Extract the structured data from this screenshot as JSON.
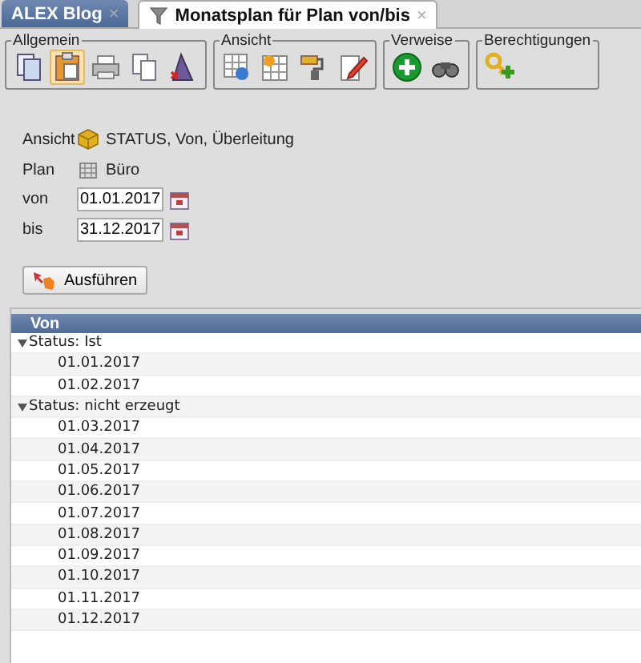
{
  "tabs": [
    {
      "label": "ALEX Blog",
      "selected": false,
      "close": "×"
    },
    {
      "label": "Monatsplan für Plan von/bis",
      "selected": true,
      "close": "×"
    }
  ],
  "toolbar": [
    {
      "title": "Allgemein",
      "buttons": [
        {
          "pressed": false
        },
        {
          "pressed": true
        },
        {
          "pressed": false
        },
        {
          "pressed": false
        },
        {
          "pressed": false
        }
      ]
    },
    {
      "title": "Ansicht",
      "buttons": [
        {
          "pressed": false
        },
        {
          "pressed": false
        },
        {
          "pressed": false
        },
        {
          "pressed": false
        }
      ]
    },
    {
      "title": "Verweise",
      "buttons": [
        {
          "pressed": false
        },
        {
          "pressed": false
        }
      ]
    },
    {
      "title": "Berechtigungen",
      "buttons": [
        {
          "pressed": false
        }
      ]
    }
  ],
  "form": {
    "ansicht": {
      "label": "Ansicht",
      "value": "STATUS, Von, Überleitung"
    },
    "plan": {
      "label": "Plan",
      "value": "Büro"
    },
    "von": {
      "label": "von",
      "value": "01.01.2017"
    },
    "bis": {
      "label": "bis",
      "value": "31.12.2017"
    },
    "run_button": "Ausführen"
  },
  "table": {
    "columns": [
      "Von"
    ],
    "groups": [
      {
        "label": "Status: Ist",
        "expanded": true,
        "children": [
          {
            "label": "01.01.2017"
          },
          {
            "label": "01.02.2017"
          }
        ]
      },
      {
        "label": "Status: nicht erzeugt",
        "expanded": true,
        "children": [
          {
            "label": "01.03.2017"
          },
          {
            "label": "01.04.2017"
          },
          {
            "label": "01.05.2017"
          },
          {
            "label": "01.06.2017"
          },
          {
            "label": "01.07.2017"
          },
          {
            "label": "01.08.2017"
          },
          {
            "label": "01.09.2017"
          },
          {
            "label": "01.10.2017"
          },
          {
            "label": "01.11.2017"
          },
          {
            "label": "01.12.2017"
          }
        ]
      }
    ]
  }
}
